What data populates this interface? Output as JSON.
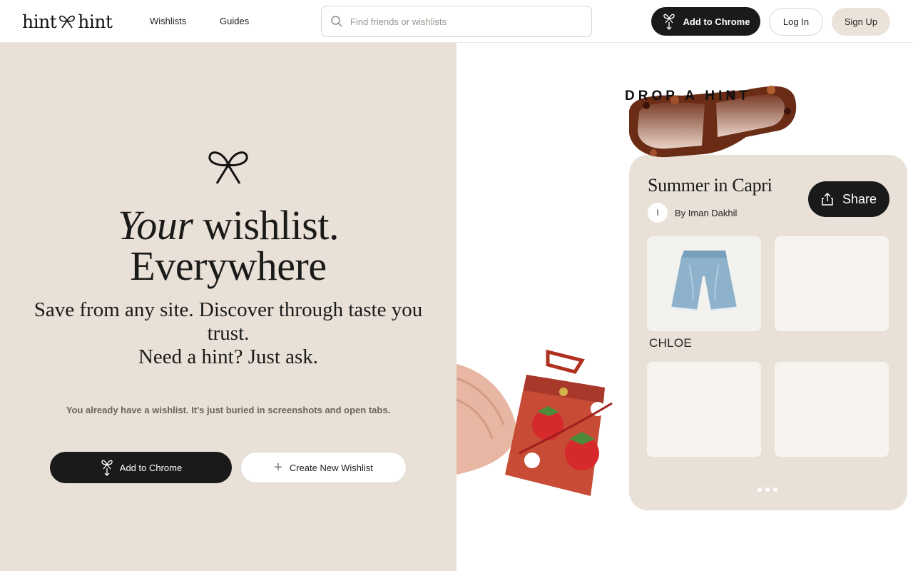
{
  "header": {
    "logo_left": "hint",
    "logo_right": "hint",
    "nav": [
      "Wishlists",
      "Guides"
    ],
    "search_placeholder": "Find friends or wishlists",
    "add_to_chrome": "Add to Chrome",
    "login": "Log In",
    "signup": "Sign Up"
  },
  "hero": {
    "title_italic": "Your",
    "title_rest": "wishlist.",
    "title_line2": "Everywhere",
    "subtitle_line1": "Save from any site. Discover through taste you trust.",
    "subtitle_line2": "Need a hint? Just ask.",
    "note": "You already have a wishlist. It's just buried in screenshots and open tabs.",
    "add_to_chrome": "Add to Chrome",
    "create_wishlist": "Create New Wishlist"
  },
  "showcase": {
    "tagline": "DROP A HINT",
    "wishlist_title": "Summer in Capri",
    "author_initial": "I",
    "author": "By Iman Dakhil",
    "share": "Share",
    "item_brand": "CHLOE"
  },
  "colors": {
    "beige": "#e9e1d7",
    "dark": "#1a1a1a",
    "muted_text": "#6b645c"
  }
}
